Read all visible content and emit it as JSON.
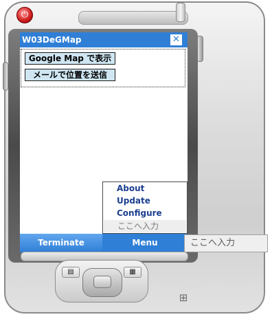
{
  "device": {
    "power_glyph": "⏻",
    "left_softkey_glyph": "▤",
    "right_softkey_glyph": "▦",
    "os_logo_glyph": "⊞"
  },
  "app": {
    "title": "W03DeGMap",
    "close_glyph": "✕",
    "buttons": {
      "google_map": "Google Map で表示",
      "send_mail": "メールで位置を送信"
    }
  },
  "menu_popup": {
    "items": [
      "About",
      "Update",
      "Configure"
    ],
    "ime_label": "ここへ入力"
  },
  "softkeys": {
    "left": "Terminate",
    "right": "Menu"
  },
  "ime_box": {
    "label": "ここへ入力"
  },
  "colors": {
    "titlebar": "#2f7fd6",
    "button_face": "#cfe6f2",
    "menu_text": "#1c3f8f"
  }
}
